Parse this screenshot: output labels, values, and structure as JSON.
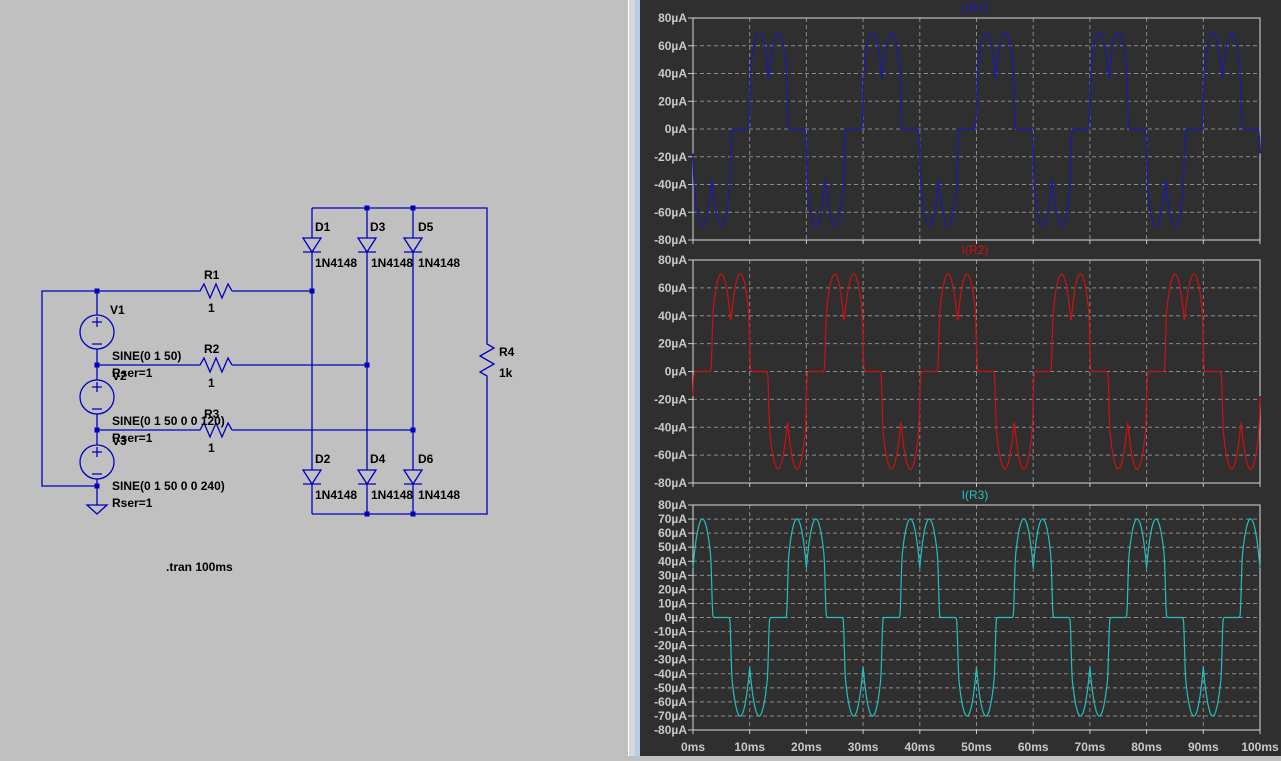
{
  "schematic": {
    "sources": [
      {
        "name": "V1",
        "value": "SINE(0 1 50)",
        "rser": "Rser=1"
      },
      {
        "name": "V2",
        "value": "SINE(0 1 50 0 0 120)",
        "rser": "Rser=1"
      },
      {
        "name": "V3",
        "value": "SINE(0 1 50 0 0 240)",
        "rser": "Rser=1"
      }
    ],
    "resistors": [
      {
        "name": "R1",
        "value": "1"
      },
      {
        "name": "R2",
        "value": "1"
      },
      {
        "name": "R3",
        "value": "1"
      },
      {
        "name": "R4",
        "value": "1k"
      }
    ],
    "diodes": [
      {
        "name": "D1",
        "model": "1N4148"
      },
      {
        "name": "D2",
        "model": "1N4148"
      },
      {
        "name": "D3",
        "model": "1N4148"
      },
      {
        "name": "D4",
        "model": "1N4148"
      },
      {
        "name": "D5",
        "model": "1N4148"
      },
      {
        "name": "D6",
        "model": "1N4148"
      }
    ],
    "directive": ".tran 100ms",
    "wire_color": "#0000c0"
  },
  "chart_data": [
    {
      "type": "line",
      "title": "I(R1)",
      "color": "#1a1ab4",
      "xlabel": "",
      "ylabel": "",
      "xlim": [
        0,
        100
      ],
      "ylim": [
        -80,
        80
      ],
      "xticks": [
        "0ms",
        "10ms",
        "20ms",
        "30ms",
        "40ms",
        "50ms",
        "60ms",
        "70ms",
        "80ms",
        "90ms",
        "100ms"
      ],
      "yticks": [
        "80µA",
        "60µA",
        "40µA",
        "20µA",
        "0µA",
        "-20µA",
        "-40µA",
        "-60µA",
        "-80µA"
      ],
      "grid": true,
      "waveform": {
        "frequency_hz": 50,
        "peak_uA": 70,
        "dip_uA": 35,
        "positive_center_ms": 13.33
      }
    },
    {
      "type": "line",
      "title": "I(R2)",
      "color": "#d01010",
      "xlabel": "",
      "ylabel": "",
      "xlim": [
        0,
        100
      ],
      "ylim": [
        -80,
        80
      ],
      "xticks": [
        "0ms",
        "10ms",
        "20ms",
        "30ms",
        "40ms",
        "50ms",
        "60ms",
        "70ms",
        "80ms",
        "90ms",
        "100ms"
      ],
      "yticks": [
        "80µA",
        "60µA",
        "40µA",
        "20µA",
        "0µA",
        "-20µA",
        "-40µA",
        "-60µA",
        "-80µA"
      ],
      "grid": true,
      "waveform": {
        "frequency_hz": 50,
        "peak_uA": 70,
        "dip_uA": 35,
        "positive_center_ms": 6.67
      }
    },
    {
      "type": "line",
      "title": "I(R3)",
      "color": "#20c0c0",
      "xlabel": "",
      "ylabel": "",
      "xlim": [
        0,
        100
      ],
      "ylim": [
        -80,
        80
      ],
      "xticks": [
        "0ms",
        "10ms",
        "20ms",
        "30ms",
        "40ms",
        "50ms",
        "60ms",
        "70ms",
        "80ms",
        "90ms",
        "100ms"
      ],
      "yticks": [
        "80µA",
        "70µA",
        "60µA",
        "50µA",
        "40µA",
        "30µA",
        "20µA",
        "10µA",
        "0µA",
        "-10µA",
        "-20µA",
        "-30µA",
        "-40µA",
        "-50µA",
        "-60µA",
        "-70µA",
        "-80µA"
      ],
      "grid": true,
      "waveform": {
        "frequency_hz": 50,
        "peak_uA": 70,
        "dip_uA": 35,
        "positive_center_ms": 0
      }
    }
  ]
}
